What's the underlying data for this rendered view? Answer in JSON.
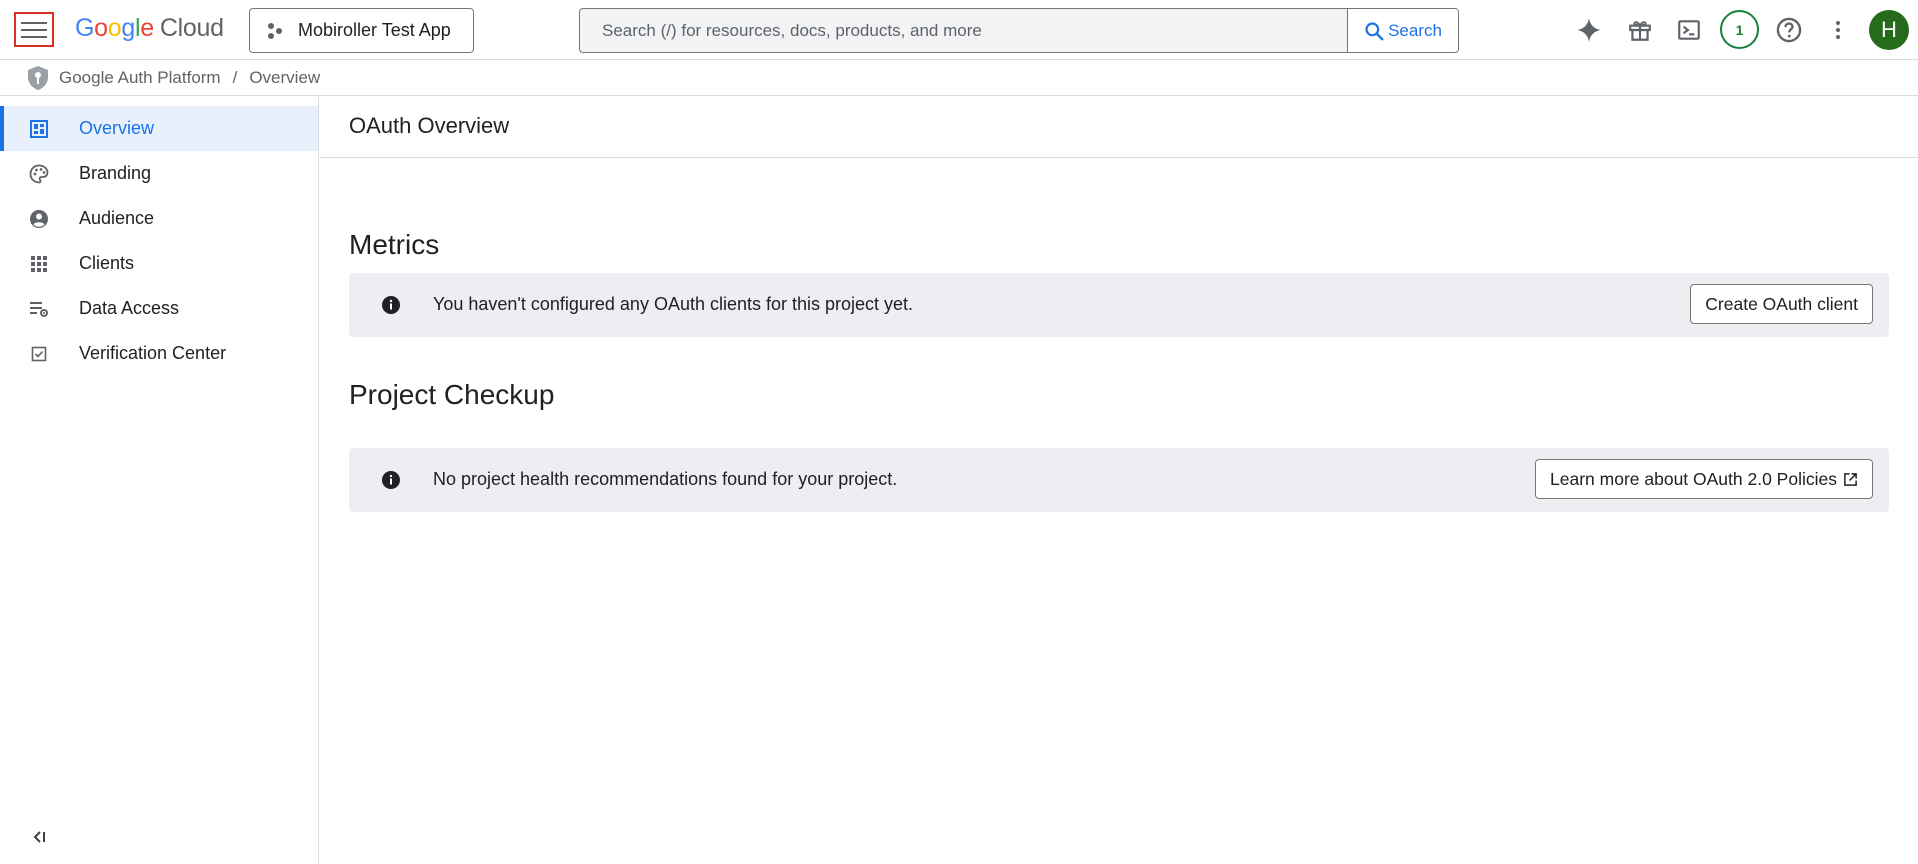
{
  "header": {
    "logo": {
      "google": "Google",
      "cloud": "Cloud"
    },
    "project_selector": "Mobiroller Test App",
    "search": {
      "placeholder": "Search (/) for resources, docs, products, and more",
      "button": "Search"
    },
    "notifications_count": "1",
    "avatar_initial": "H"
  },
  "breadcrumb": {
    "items": [
      "Google Auth Platform",
      "Overview"
    ],
    "separator": "/"
  },
  "sidebar": {
    "items": [
      {
        "label": "Overview",
        "icon": "dashboard-icon",
        "active": true
      },
      {
        "label": "Branding",
        "icon": "palette-icon"
      },
      {
        "label": "Audience",
        "icon": "account-circle-icon"
      },
      {
        "label": "Clients",
        "icon": "apps-grid-icon"
      },
      {
        "label": "Data Access",
        "icon": "data-settings-icon"
      },
      {
        "label": "Verification Center",
        "icon": "check-box-icon"
      }
    ],
    "collapse_icon": "collapse-sidebar-icon"
  },
  "main": {
    "title": "OAuth Overview",
    "metrics": {
      "heading": "Metrics",
      "message": "You haven't configured any OAuth clients for this project yet.",
      "button": "Create OAuth client"
    },
    "checkup": {
      "heading": "Project Checkup",
      "message": "No project health recommendations found for your project.",
      "button": "Learn more about OAuth 2.0 Policies"
    }
  },
  "colors": {
    "accent": "#1a73e8",
    "active_bg": "#e8f0fe",
    "notice_bg": "#eceef1",
    "avatar": "#256b1b",
    "notif": "#188038"
  }
}
